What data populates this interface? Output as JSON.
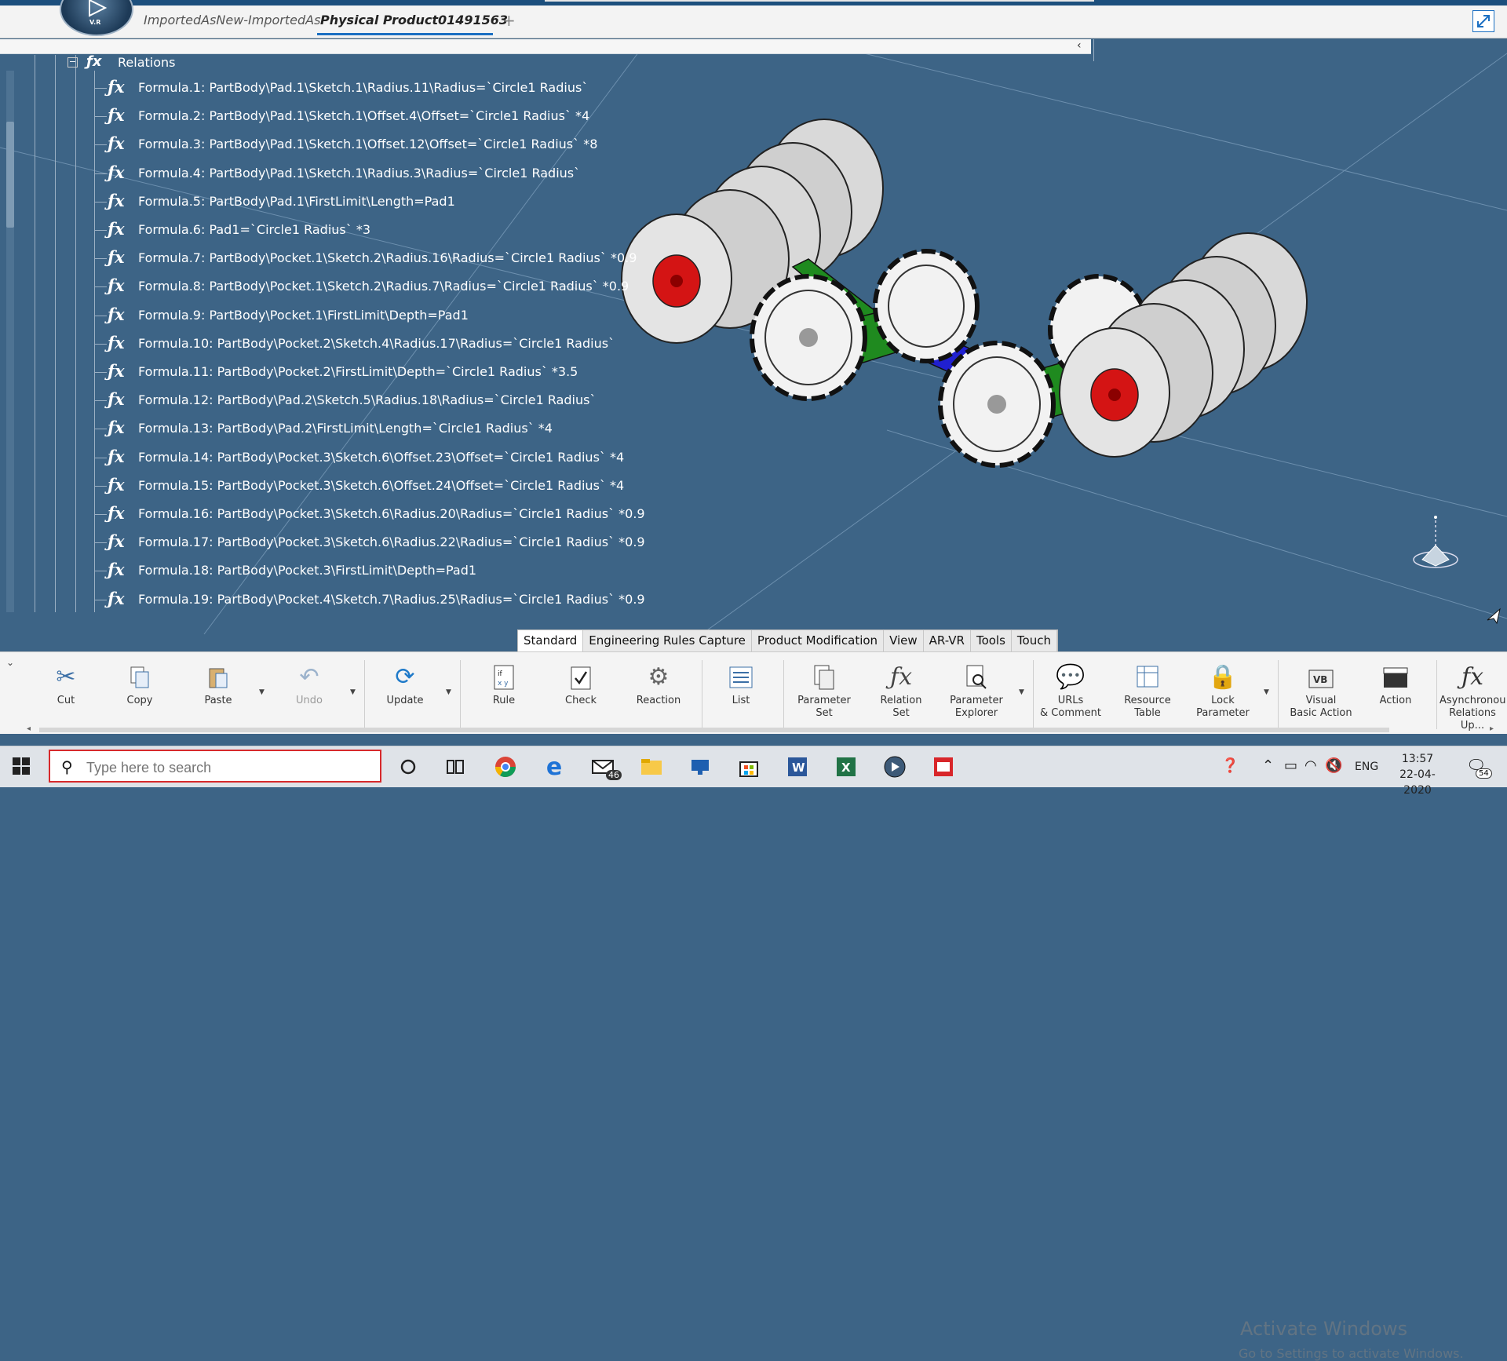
{
  "tabs": {
    "doc1": "ImportedAsNew-ImportedAs",
    "doc2": "Physical Product01491563",
    "new_tab": "+"
  },
  "logo_text": "V.R",
  "tree": {
    "node_label": "Relations",
    "formulas": [
      "Formula.1: PartBody\\Pad.1\\Sketch.1\\Radius.11\\Radius=`Circle1 Radius`",
      "Formula.2: PartBody\\Pad.1\\Sketch.1\\Offset.4\\Offset=`Circle1 Radius` *4",
      "Formula.3: PartBody\\Pad.1\\Sketch.1\\Offset.12\\Offset=`Circle1 Radius` *8",
      "Formula.4: PartBody\\Pad.1\\Sketch.1\\Radius.3\\Radius=`Circle1 Radius`",
      "Formula.5: PartBody\\Pad.1\\FirstLimit\\Length=Pad1",
      "Formula.6: Pad1=`Circle1 Radius` *3",
      "Formula.7: PartBody\\Pocket.1\\Sketch.2\\Radius.16\\Radius=`Circle1 Radius` *0.9",
      "Formula.8: PartBody\\Pocket.1\\Sketch.2\\Radius.7\\Radius=`Circle1 Radius` *0.9",
      "Formula.9: PartBody\\Pocket.1\\FirstLimit\\Depth=Pad1",
      "Formula.10: PartBody\\Pocket.2\\Sketch.4\\Radius.17\\Radius=`Circle1 Radius`",
      "Formula.11: PartBody\\Pocket.2\\FirstLimit\\Depth=`Circle1 Radius` *3.5",
      "Formula.12: PartBody\\Pad.2\\Sketch.5\\Radius.18\\Radius=`Circle1 Radius`",
      "Formula.13: PartBody\\Pad.2\\FirstLimit\\Length=`Circle1 Radius` *4",
      "Formula.14: PartBody\\Pocket.3\\Sketch.6\\Offset.23\\Offset=`Circle1 Radius` *4",
      "Formula.15: PartBody\\Pocket.3\\Sketch.6\\Offset.24\\Offset=`Circle1 Radius` *4",
      "Formula.16: PartBody\\Pocket.3\\Sketch.6\\Radius.20\\Radius=`Circle1 Radius` *0.9",
      "Formula.17: PartBody\\Pocket.3\\Sketch.6\\Radius.22\\Radius=`Circle1 Radius` *0.9",
      "Formula.18: PartBody\\Pocket.3\\FirstLimit\\Depth=Pad1",
      "Formula.19: PartBody\\Pocket.4\\Sketch.7\\Radius.25\\Radius=`Circle1 Radius` *0.9"
    ]
  },
  "ribbon_tabs": [
    "Standard",
    "Engineering Rules Capture",
    "Product Modification",
    "View",
    "AR-VR",
    "Tools",
    "Touch"
  ],
  "ribbon": {
    "cut": "Cut",
    "copy": "Copy",
    "paste": "Paste",
    "undo": "Undo",
    "update": "Update",
    "rule": "Rule",
    "check": "Check",
    "reaction": "Reaction",
    "list": "List",
    "parameter_set_1": "Parameter",
    "parameter_set_2": "Set",
    "relation_set_1": "Relation",
    "relation_set_2": "Set",
    "param_explorer_1": "Parameter",
    "param_explorer_2": "Explorer",
    "urls_1": "URLs",
    "urls_2": "& Comment",
    "resource_1": "Resource",
    "resource_2": "Table",
    "lock_1": "Lock",
    "lock_2": "Parameter",
    "vba_1": "Visual",
    "vba_2": "Basic Action",
    "action": "Action",
    "async_1": "Asynchronou",
    "async_2": "Relations Up..."
  },
  "watermark": {
    "line1": "Activate Windows",
    "line2": "Go to Settings to activate Windows."
  },
  "taskbar": {
    "search_placeholder": "Type here to search",
    "mail_badge": "46",
    "lang": "ENG",
    "time": "13:57",
    "date": "22-04-2020",
    "notif_count": "54"
  },
  "colors": {
    "viewport_bg": "#3d6486",
    "wheel_hub_red": "#d41414",
    "chassis_green": "#1f8a1f",
    "axle_blue": "#2020d0",
    "tab_accent": "#1b6fc2"
  }
}
